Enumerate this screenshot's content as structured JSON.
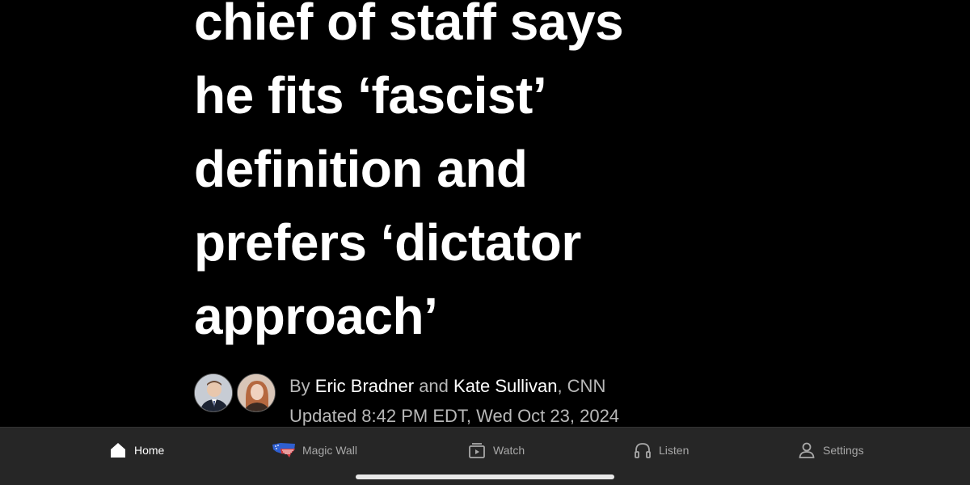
{
  "headline": {
    "lines": [
      "chief of staff says",
      "he fits ‘fascist’",
      "definition and",
      "prefers ‘dictator",
      "approach’"
    ]
  },
  "byline": {
    "prefix": "By ",
    "author1": "Eric Bradner",
    "conjunction": " and ",
    "author2": "Kate Sullivan",
    "source": ", CNN",
    "updated": "Updated 8:42 PM EDT, Wed Oct 23, 2024"
  },
  "tabbar": {
    "items": [
      {
        "label": "Home",
        "icon": "home-icon",
        "active": true
      },
      {
        "label": "Magic Wall",
        "icon": "us-map-flag-icon",
        "active": false
      },
      {
        "label": "Watch",
        "icon": "play-stack-icon",
        "active": false
      },
      {
        "label": "Listen",
        "icon": "headphones-icon",
        "active": false
      },
      {
        "label": "Settings",
        "icon": "person-icon",
        "active": false
      }
    ]
  },
  "colors": {
    "background": "#000000",
    "tabbar_background": "#262626",
    "active_tab": "#ffffff",
    "inactive_tab": "#a8a8a8",
    "map_blue": "#2f5fd0",
    "map_red": "#d23a3a"
  }
}
